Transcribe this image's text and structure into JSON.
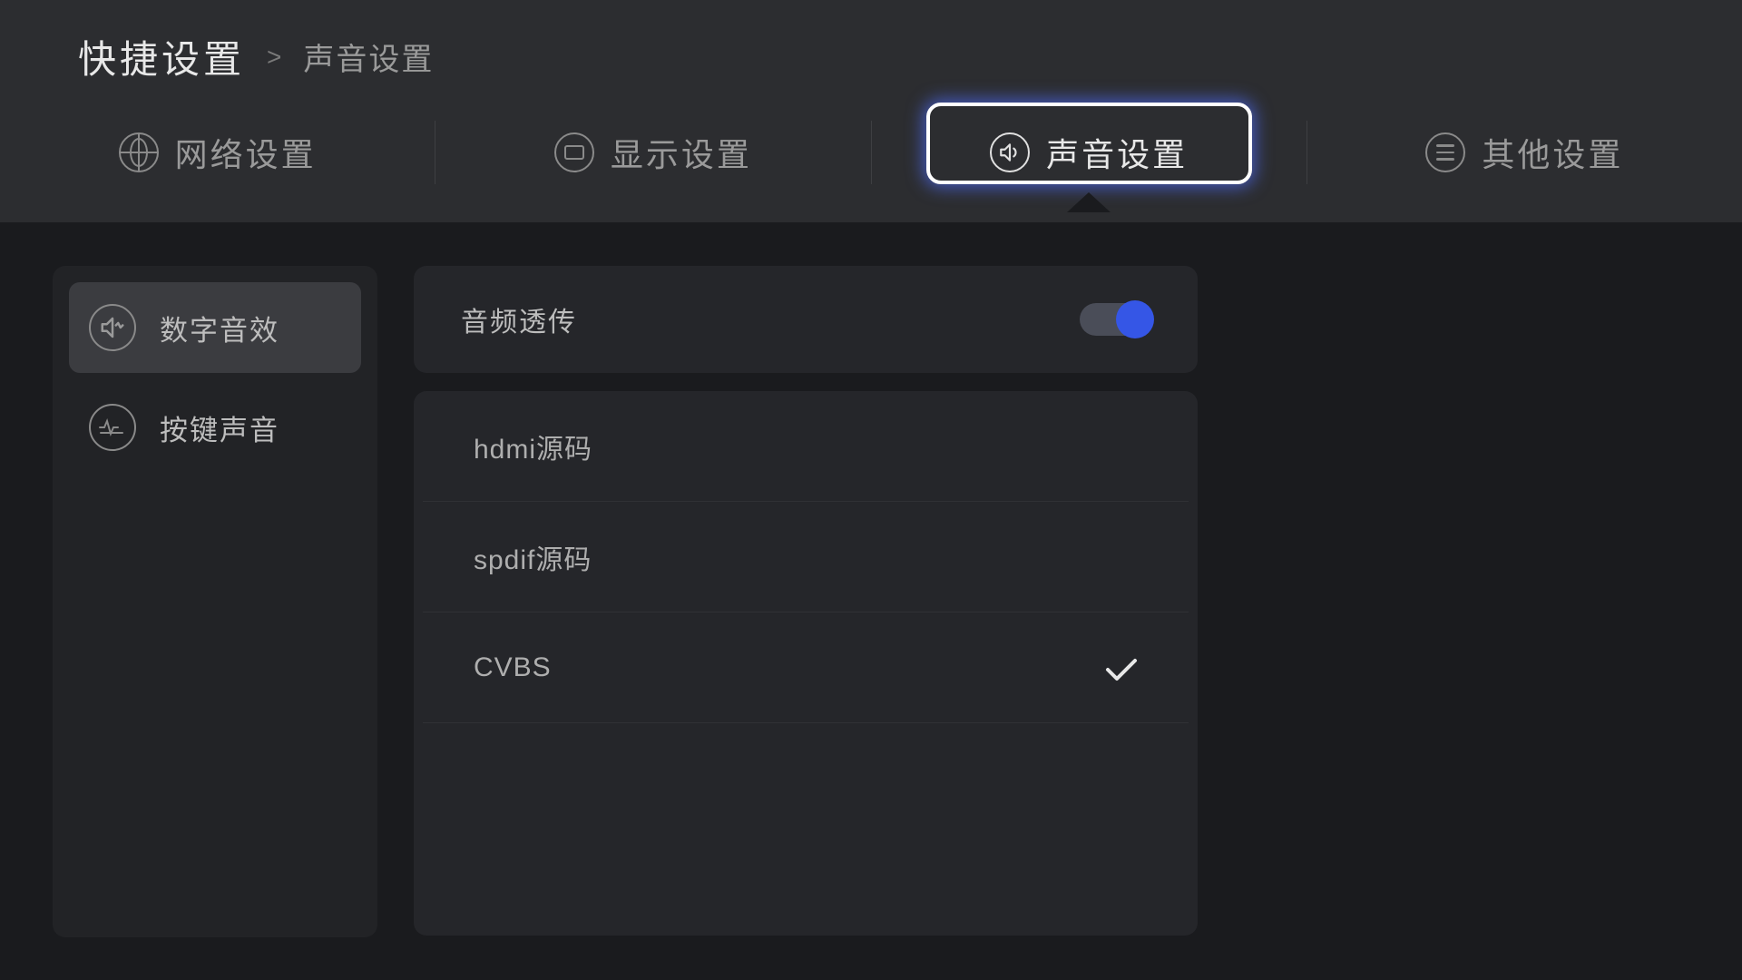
{
  "breadcrumb": {
    "main": "快捷设置",
    "separator": ">",
    "sub": "声音设置"
  },
  "tabs": [
    {
      "id": "network",
      "label": "网络设置",
      "icon": "globe-icon",
      "active": false
    },
    {
      "id": "display",
      "label": "显示设置",
      "icon": "display-icon",
      "active": false
    },
    {
      "id": "audio",
      "label": "声音设置",
      "icon": "speaker-icon",
      "active": true
    },
    {
      "id": "other",
      "label": "其他设置",
      "icon": "menu-icon",
      "active": false
    }
  ],
  "sidebar": {
    "items": [
      {
        "id": "digital-sfx",
        "label": "数字音效",
        "icon": "wave-icon",
        "active": true
      },
      {
        "id": "key-sound",
        "label": "按键声音",
        "icon": "pulse-icon",
        "active": false
      }
    ]
  },
  "main": {
    "toggle": {
      "label": "音频透传",
      "on": true
    },
    "options": [
      {
        "id": "hdmi",
        "label": "hdmi源码",
        "checked": false
      },
      {
        "id": "spdif",
        "label": "spdif源码",
        "checked": false
      },
      {
        "id": "cvbs",
        "label": "CVBS",
        "checked": true
      }
    ]
  },
  "colors": {
    "accent": "#3556e6",
    "focus_glow": "#5b72ff"
  }
}
